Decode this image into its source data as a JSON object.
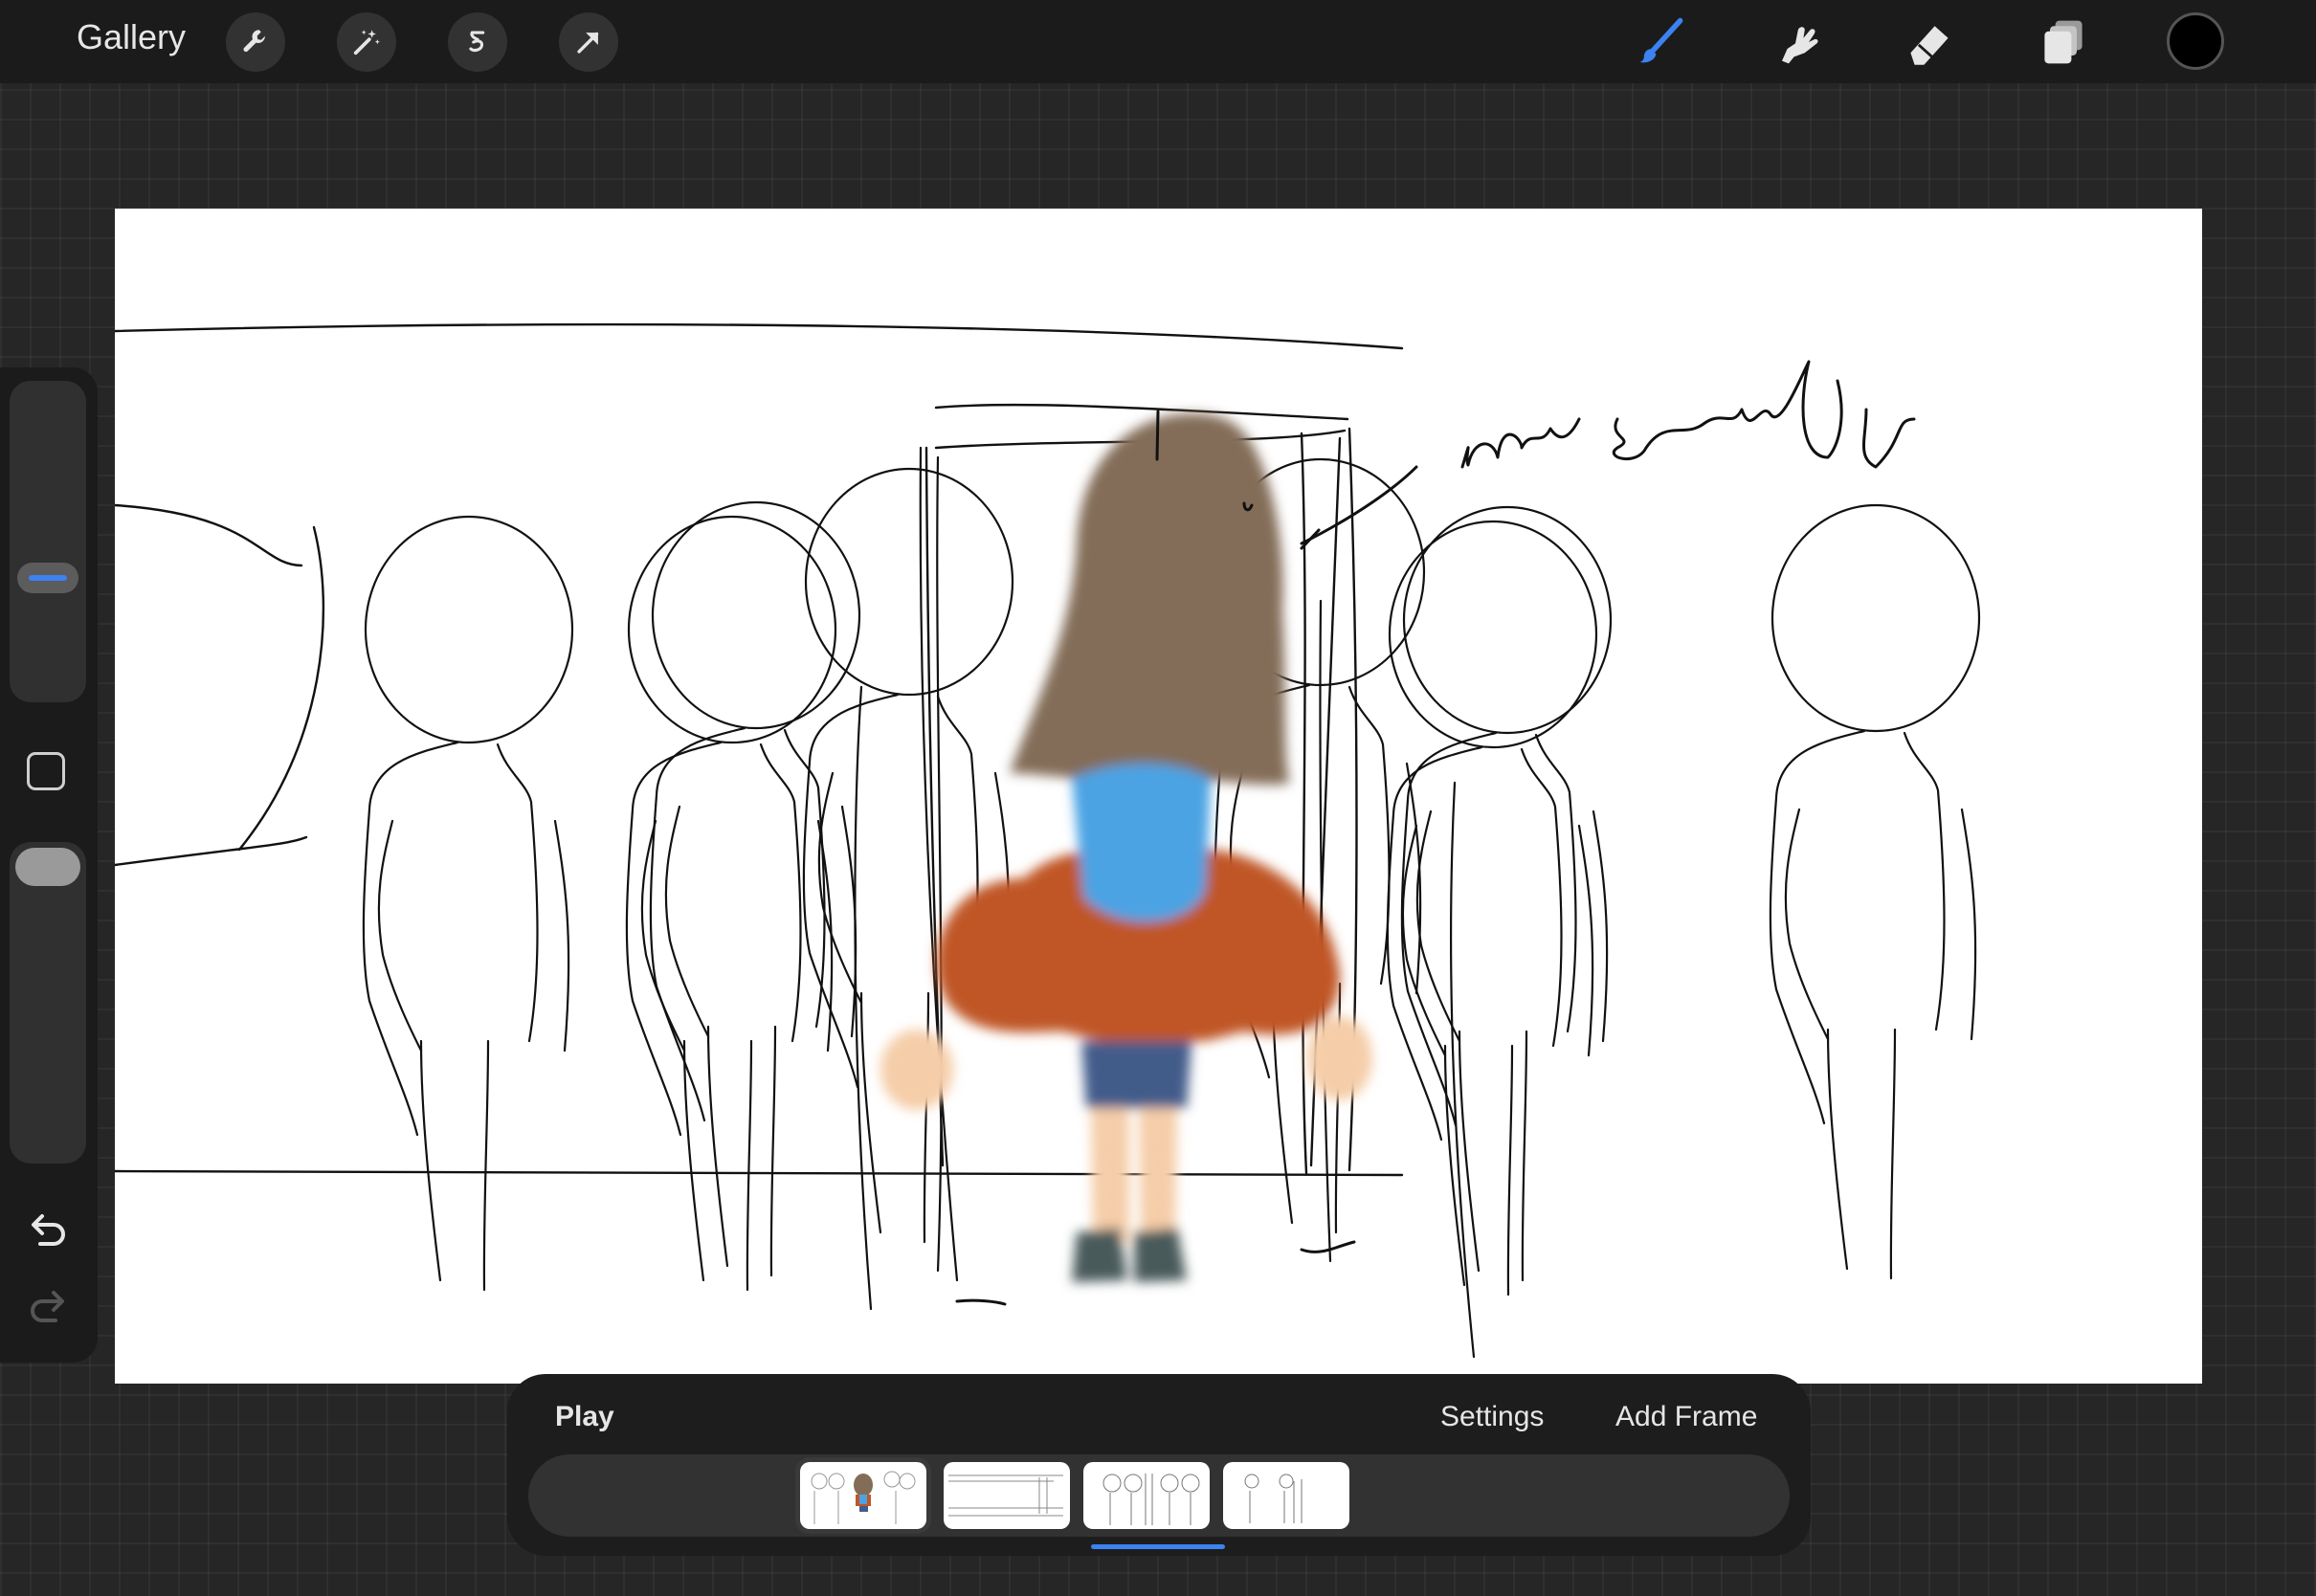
{
  "topbar": {
    "gallery_label": "Gallery",
    "left_tools": [
      {
        "name": "wrench-icon",
        "label": "Actions"
      },
      {
        "name": "magic-wand-icon",
        "label": "Adjustments"
      },
      {
        "name": "selection-icon",
        "label": "Selection"
      },
      {
        "name": "transform-arrow-icon",
        "label": "Transform"
      }
    ],
    "right_tools": [
      {
        "name": "brush-icon",
        "label": "Paint",
        "active": true
      },
      {
        "name": "smudge-icon",
        "label": "Smudge"
      },
      {
        "name": "eraser-icon",
        "label": "Erase"
      },
      {
        "name": "layers-icon",
        "label": "Layers"
      }
    ],
    "current_color": "#000000",
    "accent_color": "#3c82f0"
  },
  "sidebar": {
    "brush_size_level": 0.57,
    "brush_opacity_level": 1.0,
    "modify_button": "square-modify-icon",
    "undo_icon": "undo-icon",
    "redo_icon": "redo-icon"
  },
  "canvas": {
    "annotation": "hair swaying"
  },
  "animation": {
    "play_label": "Play",
    "settings_label": "Settings",
    "add_frame_label": "Add Frame",
    "frames": [
      {
        "name": "frame-1",
        "selected": false,
        "onion_skin": true
      },
      {
        "name": "frame-2",
        "selected": false
      },
      {
        "name": "frame-3",
        "selected": true
      },
      {
        "name": "frame-4",
        "selected": false
      }
    ]
  }
}
